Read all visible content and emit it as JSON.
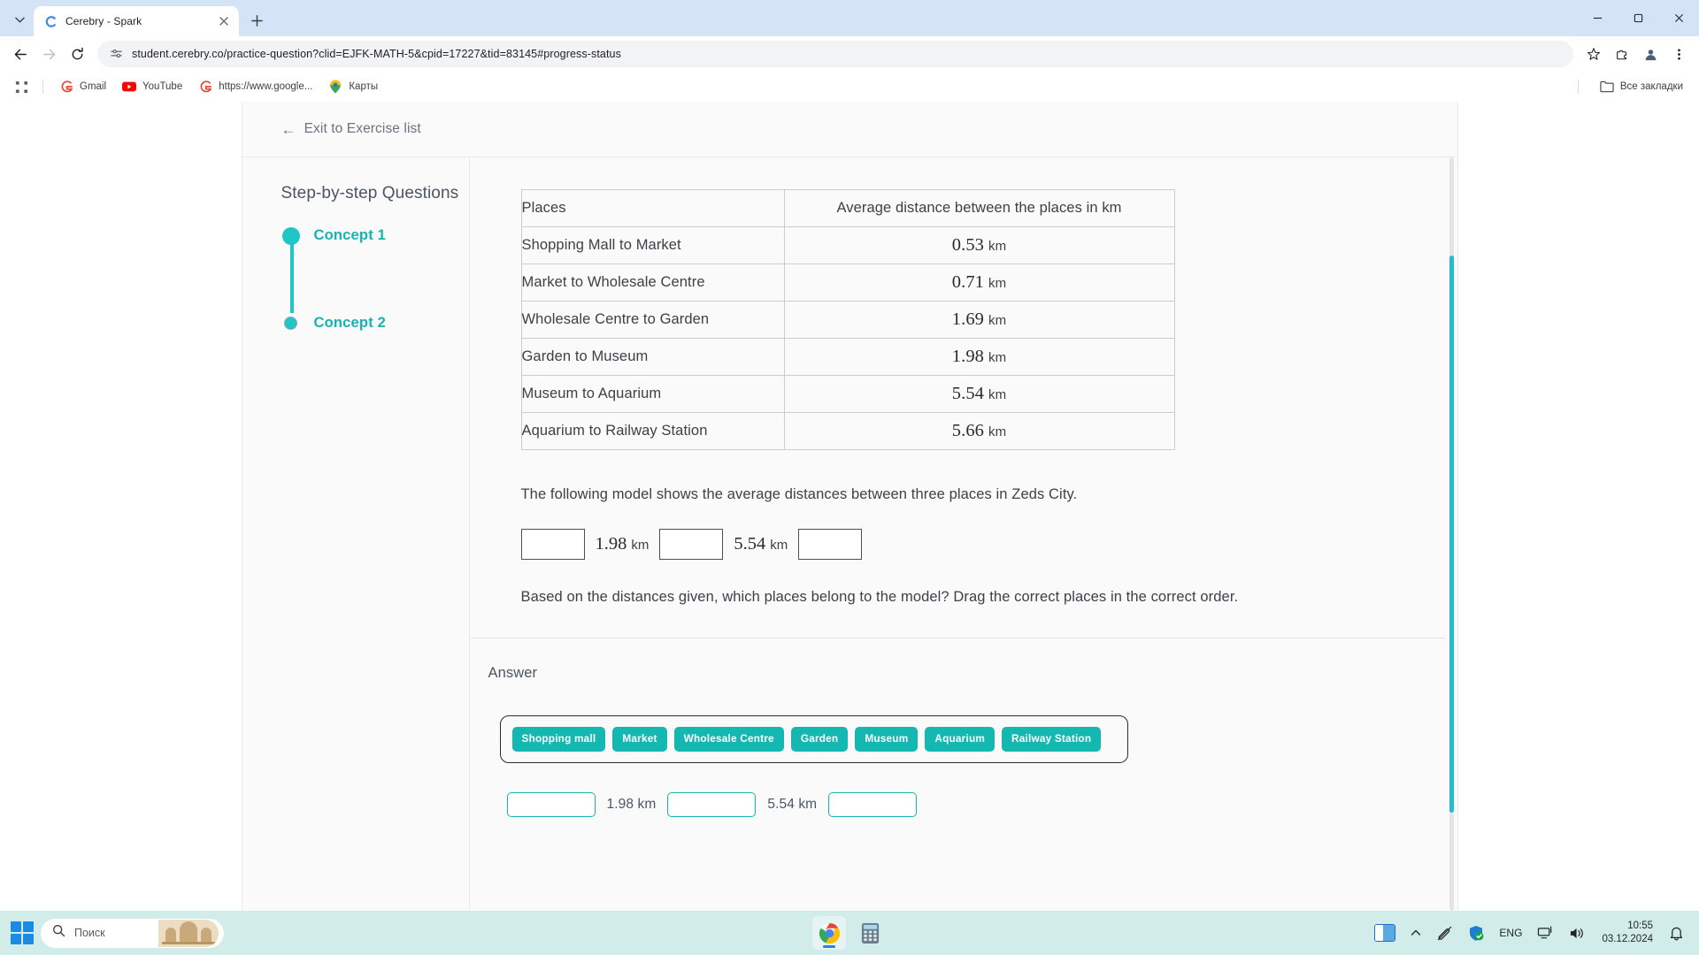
{
  "browser": {
    "tab": {
      "title": "Cerebry - Spark",
      "favicon": "cerebry-logo",
      "close_label": "×"
    },
    "new_tab_label": "+",
    "tab_list_chevron": "⌄",
    "window_controls": {
      "minimize": "—",
      "maximize": "▢",
      "close": "✕"
    },
    "nav": {
      "back": "←",
      "forward": "→",
      "reload": "⟳"
    },
    "omnibox": {
      "url": "student.cerebry.co/practice-question?clid=EJFK-MATH-5&cpid=17227&tid=83145#progress-status",
      "site_info_icon": "tune-icon",
      "bookmark_icon": "star-icon"
    },
    "toolbar_right": {
      "extensions": "extensions-icon",
      "profile": "profile-icon",
      "menu": "kebab-menu-icon"
    },
    "bookmarks": {
      "apps_icon": "apps-grid-icon",
      "items": [
        {
          "label": "Gmail",
          "icon": "gmail-icon"
        },
        {
          "label": "YouTube",
          "icon": "youtube-icon"
        },
        {
          "label": "https://www.google...",
          "icon": "google-icon"
        },
        {
          "label": "Карты",
          "icon": "maps-pin-icon"
        }
      ],
      "all_bookmarks": {
        "label": "Все закладки",
        "icon": "folder-icon"
      }
    }
  },
  "page": {
    "exit_link": {
      "arrow": "←",
      "label": "Exit to Exercise list"
    },
    "sidebar": {
      "title": "Step-by-step Questions",
      "steps": [
        {
          "label": "Concept 1",
          "state": "active"
        },
        {
          "label": "Concept 2",
          "state": "pending"
        }
      ]
    },
    "question": {
      "table": {
        "headers": [
          "Places",
          "Average distance between the places in km"
        ],
        "rows": [
          {
            "places": "Shopping Mall to Market",
            "value": "0.53",
            "unit": "km"
          },
          {
            "places": "Market to Wholesale Centre",
            "value": "0.71",
            "unit": "km"
          },
          {
            "places": "Wholesale Centre to Garden",
            "value": "1.69",
            "unit": "km"
          },
          {
            "places": "Garden to Museum",
            "value": "1.98",
            "unit": "km"
          },
          {
            "places": "Museum to Aquarium",
            "value": "5.54",
            "unit": "km"
          },
          {
            "places": "Aquarium to Railway Station",
            "value": "5.66",
            "unit": "km"
          }
        ]
      },
      "intro": "The following model shows the average distances between three places in Zeds City.",
      "model": {
        "gaps": [
          {
            "value": "1.98",
            "unit": "km"
          },
          {
            "value": "5.54",
            "unit": "km"
          }
        ],
        "box_count": 3
      },
      "prompt": "Based on the distances given, which places belong to the model? Drag the correct places in the correct order."
    },
    "answer": {
      "title": "Answer",
      "chips": [
        "Shopping mall",
        "Market",
        "Wholesale Centre",
        "Garden",
        "Museum",
        "Aquarium",
        "Railway Station"
      ],
      "drop_gaps": [
        {
          "value": "1.98 km"
        },
        {
          "value": "5.54 km"
        }
      ]
    },
    "scrollbar": {
      "thumb_top_pct": 13,
      "thumb_height_pct": 74
    }
  },
  "taskbar": {
    "start_label": "start-button",
    "search": {
      "placeholder": "Поиск",
      "icon": "search-icon"
    },
    "apps": [
      {
        "name": "chrome-taskbar-icon",
        "active": true
      },
      {
        "name": "calculator-taskbar-icon",
        "active": false
      }
    ],
    "tray": {
      "widgets": "widgets-icon",
      "overflow": "^",
      "pen": "pen-off-icon",
      "security": "security-shield-icon",
      "language": "ENG",
      "network": "network-icon",
      "volume": "volume-icon",
      "time": "10:55",
      "date": "03.12.2024",
      "notifications": "bell-icon"
    }
  },
  "colors": {
    "accent_teal": "#17b3b3",
    "chip_teal": "#14b8b0",
    "scrollbar_teal": "#27bccb",
    "tab_strip": "#d5e3f7",
    "taskbar": "#d2ece9"
  }
}
